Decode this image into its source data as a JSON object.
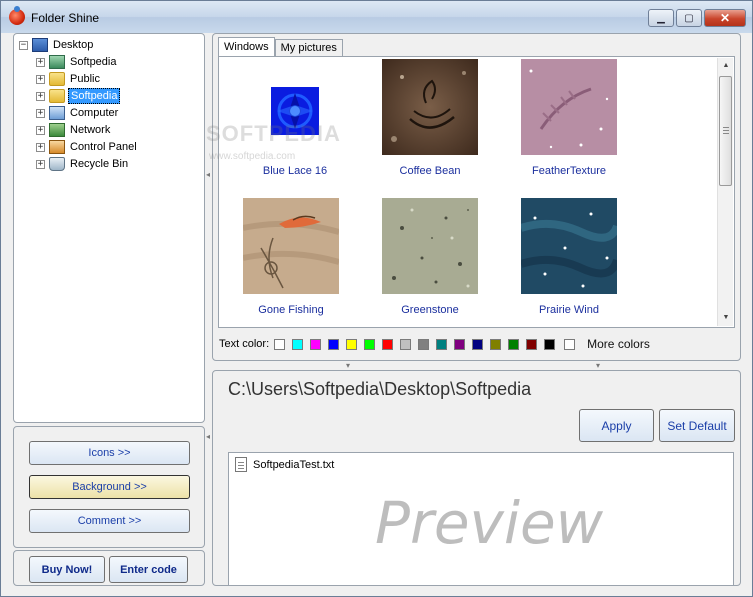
{
  "window": {
    "title": "Folder Shine"
  },
  "tree": {
    "root": "Desktop",
    "items": [
      {
        "label": "Softpedia",
        "icon": "softpedia-icon",
        "selected": false
      },
      {
        "label": "Public",
        "icon": "folder-icon",
        "selected": false
      },
      {
        "label": "Softpedia",
        "icon": "folder-icon",
        "selected": true
      },
      {
        "label": "Computer",
        "icon": "computer-icon",
        "selected": false
      },
      {
        "label": "Network",
        "icon": "network-icon",
        "selected": false
      },
      {
        "label": "Control Panel",
        "icon": "control-panel-icon",
        "selected": false
      },
      {
        "label": "Recycle Bin",
        "icon": "recycle-bin-icon",
        "selected": false
      }
    ]
  },
  "left_buttons": {
    "icons": "Icons >>",
    "background": "Background >>",
    "comment": "Comment >>"
  },
  "bottom_buttons": {
    "buy": "Buy Now!",
    "enter_code": "Enter code"
  },
  "gallery": {
    "tabs": [
      "Windows",
      "My pictures"
    ],
    "active_tab": "Windows",
    "thumbnails": [
      {
        "name": "Blue Lace 16"
      },
      {
        "name": "Coffee Bean"
      },
      {
        "name": "FeatherTexture"
      },
      {
        "name": "Gone Fishing"
      },
      {
        "name": "Greenstone"
      },
      {
        "name": "Prairie Wind"
      }
    ],
    "text_color_label": "Text color:",
    "colors": [
      "#ffffff",
      "#00ffff",
      "#ff00ff",
      "#0000ff",
      "#ffff00",
      "#00ff00",
      "#ff0000",
      "#c0c0c0",
      "#808080",
      "#008080",
      "#800080",
      "#000080",
      "#808000",
      "#008000",
      "#800000",
      "#000000"
    ],
    "more_colors": "More colors"
  },
  "watermark": {
    "main": "SOFTPEDIA",
    "sub": "www.softpedia.com"
  },
  "preview": {
    "path": "C:\\Users\\Softpedia\\Desktop\\Softpedia",
    "apply": "Apply",
    "set_default": "Set Default",
    "file": "SoftpediaTest.txt",
    "big_text": "Preview"
  }
}
